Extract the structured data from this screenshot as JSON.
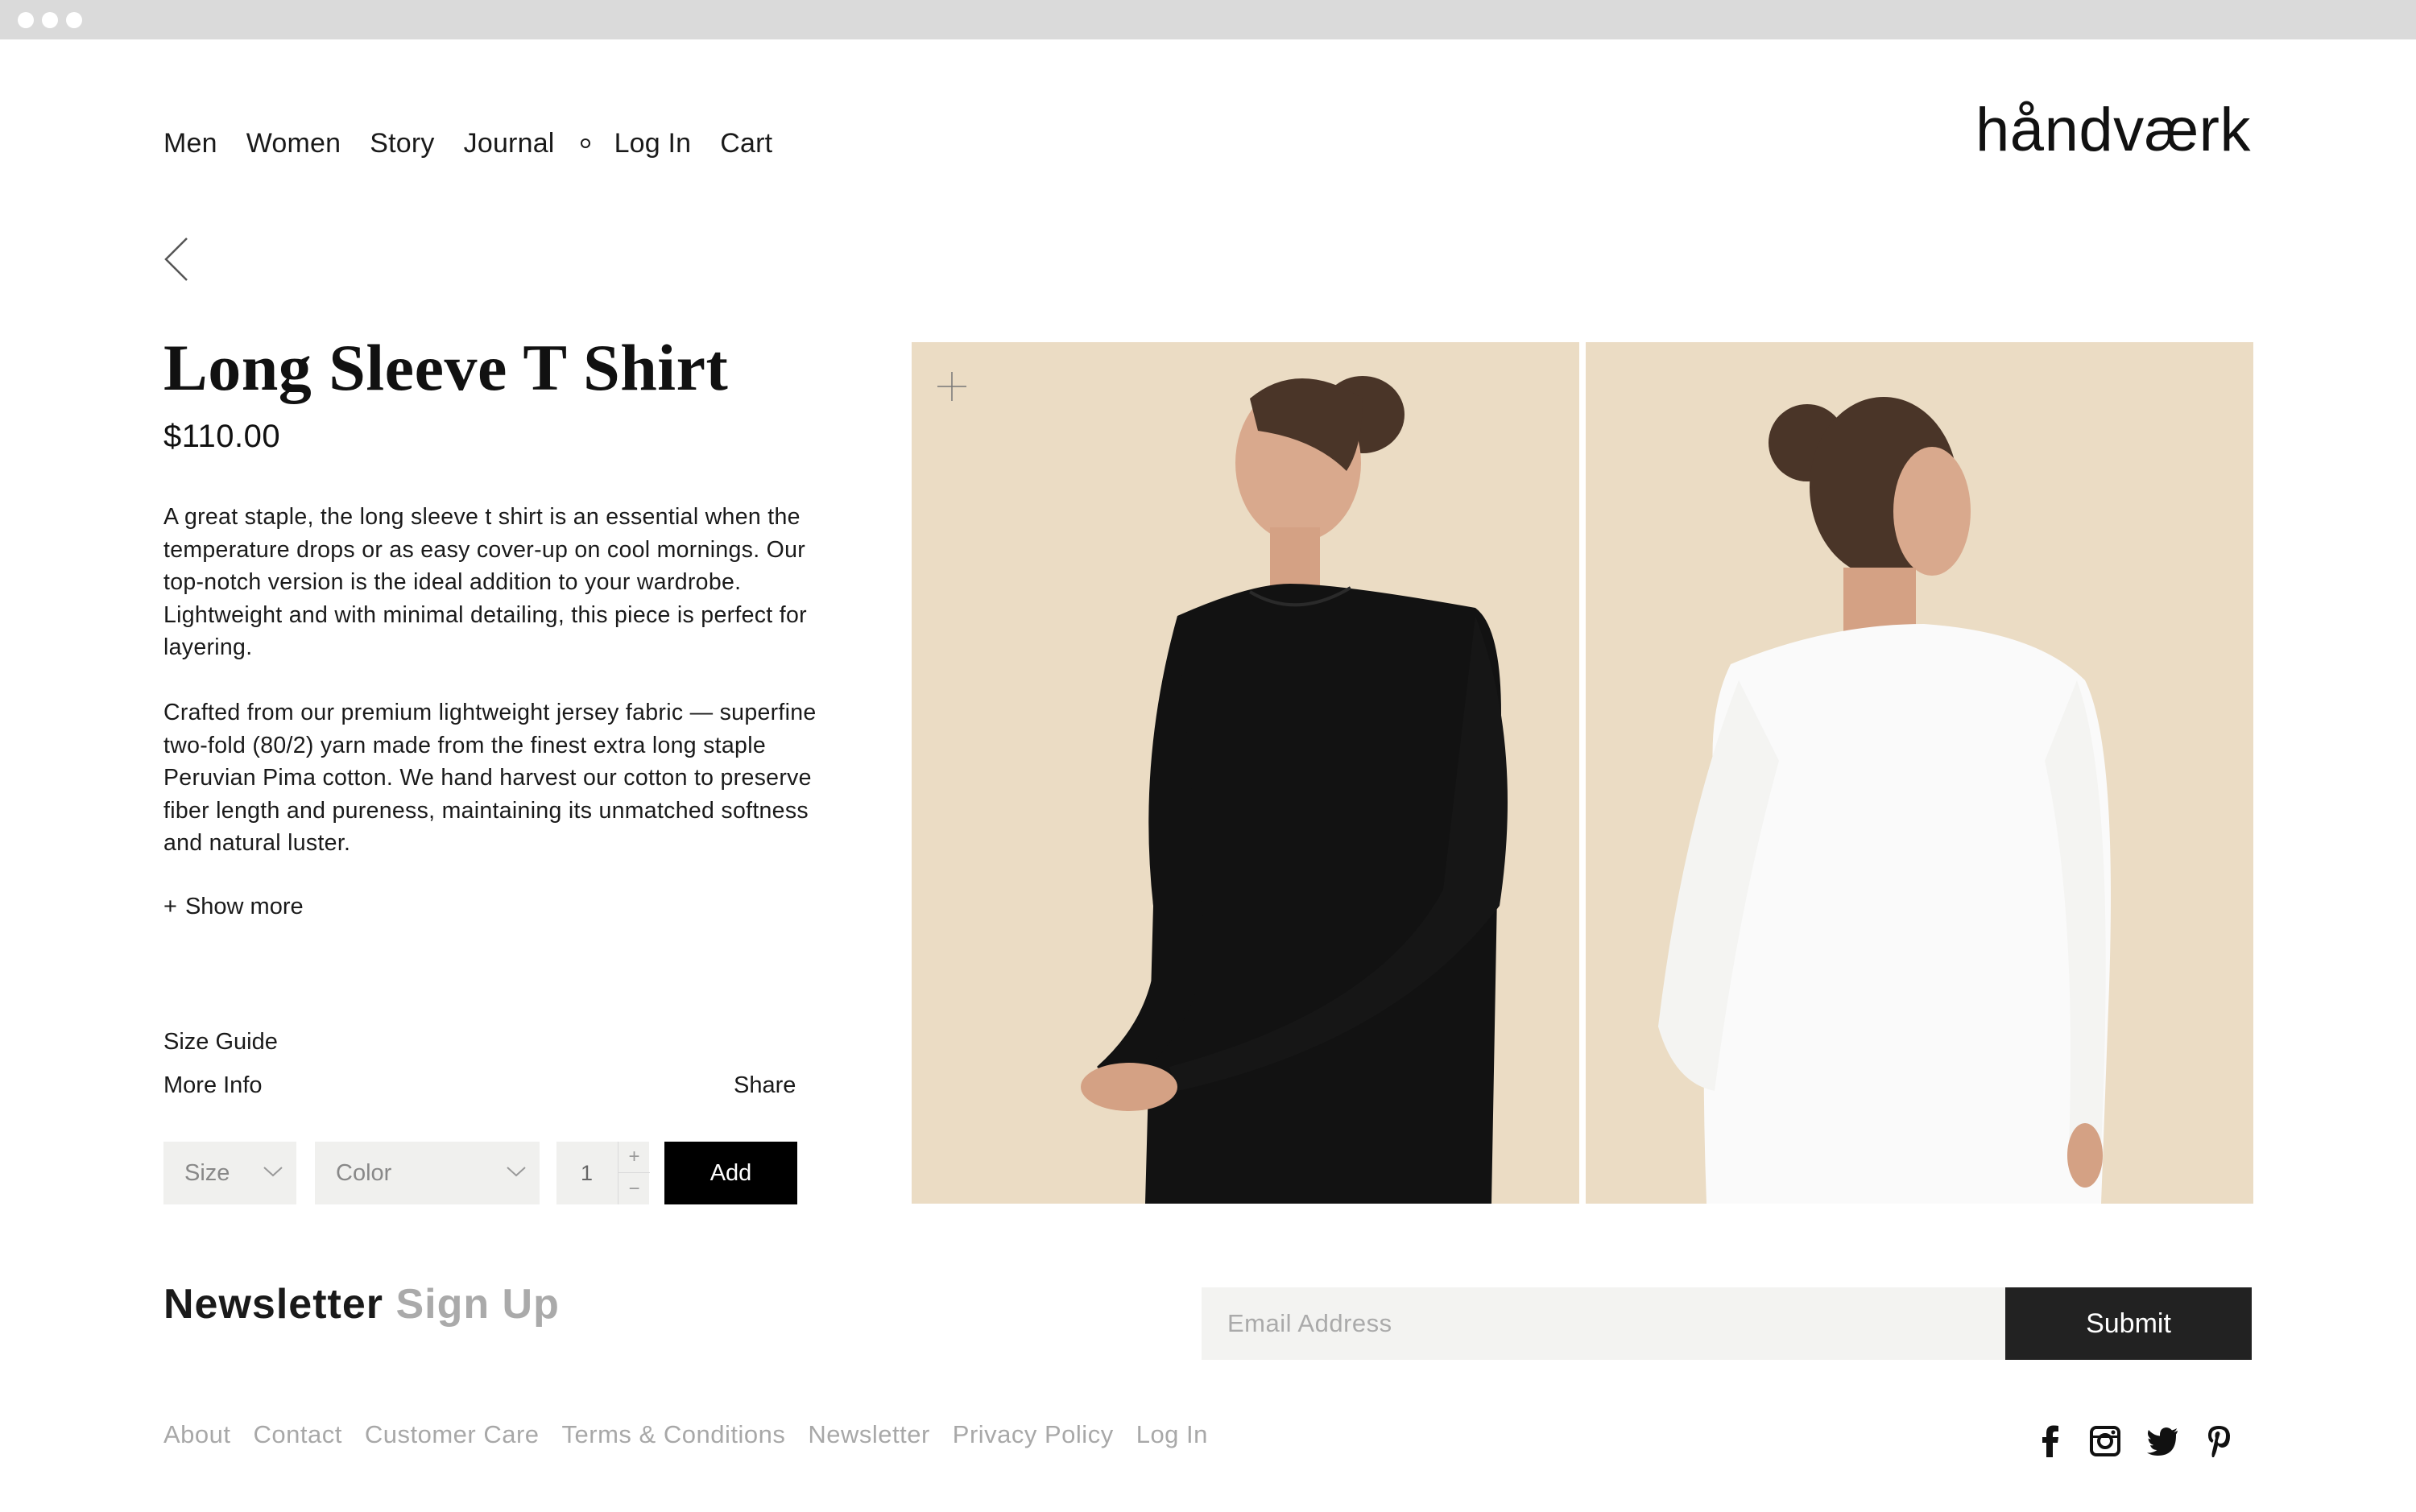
{
  "nav": {
    "items": [
      "Men",
      "Women",
      "Story",
      "Journal"
    ],
    "login": "Log In",
    "cart": "Cart"
  },
  "brand": {
    "logo": "håndværk"
  },
  "product": {
    "title": "Long Sleeve T Shirt",
    "price": "$110.00",
    "description_1": "A great staple, the long sleeve t shirt is an essential when the temperature drops or as easy cover-up on cool mornings. Our top-notch version is the ideal addition to your wardrobe. Lightweight and with minimal detailing, this piece is perfect for layering.",
    "description_2": "Crafted from our premium lightweight jersey fabric — superfine two-fold (80/2) yarn made from the finest extra long staple Peruvian Pima cotton. We hand harvest our cotton to preserve fiber length and pureness, maintaining its unmatched softness and natural luster.",
    "show_more": "Show more",
    "size_guide": "Size Guide",
    "more_info": "More Info",
    "share": "Share",
    "size_label": "Size",
    "color_label": "Color",
    "quantity": "1",
    "add_label": "Add",
    "image_bg_color": "#ebdcc4"
  },
  "newsletter": {
    "title_dark": "Newsletter",
    "title_light": "Sign Up",
    "email_placeholder": "Email Address",
    "submit_label": "Submit"
  },
  "footer": {
    "links": [
      "About",
      "Contact",
      "Customer Care",
      "Terms & Conditions",
      "Newsletter",
      "Privacy Policy",
      "Log In"
    ],
    "social_icons": [
      "facebook-icon",
      "instagram-icon",
      "twitter-icon",
      "pinterest-icon"
    ]
  }
}
